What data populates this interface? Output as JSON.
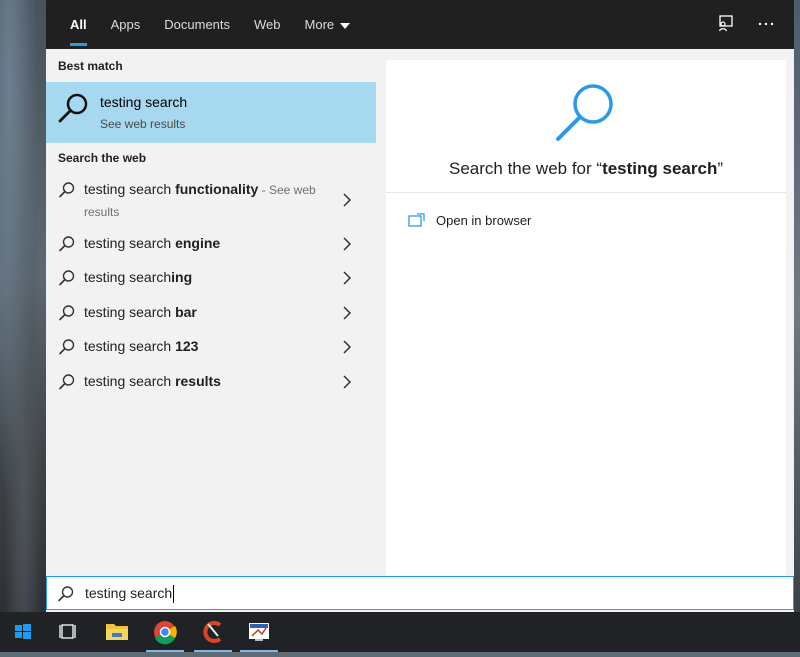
{
  "tabs": [
    {
      "label": "All"
    },
    {
      "label": "Apps"
    },
    {
      "label": "Documents"
    },
    {
      "label": "Web"
    },
    {
      "label": "More"
    }
  ],
  "topbar_icons": [
    "feedback-icon",
    "more-options-icon"
  ],
  "left": {
    "best_match_title": "Best match",
    "best_match": {
      "title": "testing search",
      "subtitle": "See web results"
    },
    "web_section_title": "Search the web",
    "web_items": [
      {
        "prefix": "testing search ",
        "bold": "functionality",
        "suffix": " - See web results"
      },
      {
        "prefix": "testing search ",
        "bold": "engine"
      },
      {
        "prefix": "testing search",
        "bold": "ing"
      },
      {
        "prefix": "testing search ",
        "bold": "bar"
      },
      {
        "prefix": "testing search ",
        "bold": "123"
      },
      {
        "prefix": "testing search ",
        "bold": "results"
      }
    ]
  },
  "right": {
    "title_prefix": "Search the web for “",
    "title_query": "testing search",
    "title_suffix": "”",
    "open_in_browser": "Open in browser"
  },
  "search": {
    "value": "testing search"
  },
  "taskbar": {
    "items": [
      "windows-start-icon",
      "task-view-icon",
      "file-explorer-icon",
      "chrome-icon",
      "ccleaner-icon",
      "app-icon"
    ]
  },
  "colors": {
    "accent": "#2b9ae6",
    "selected": "#a6d8f0",
    "topbar": "#202020"
  }
}
